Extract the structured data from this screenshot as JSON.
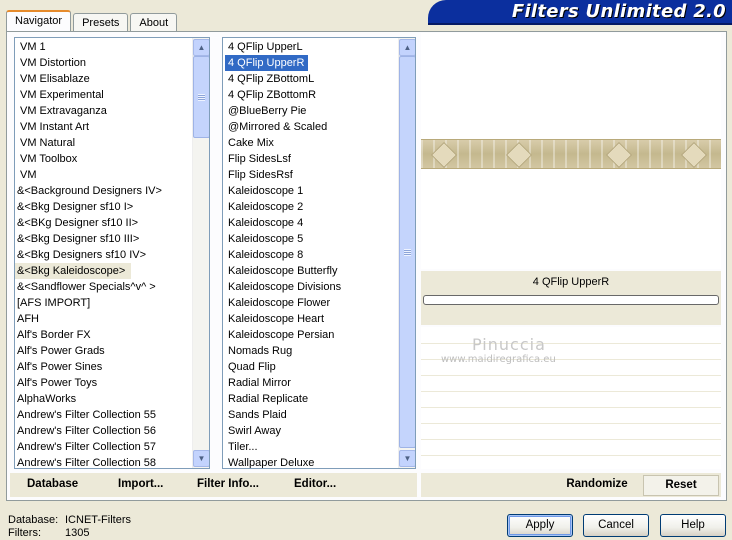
{
  "tabs": [
    "Navigator",
    "Presets",
    "About"
  ],
  "app_title": "Filters Unlimited 2.0",
  "categories": [
    "VM 1",
    "VM Distortion",
    "VM Elisablaze",
    "VM Experimental",
    "VM Extravaganza",
    "VM Instant Art",
    "VM Natural",
    "VM Toolbox",
    "VM",
    "&<Background Designers IV>",
    "&<Bkg Designer sf10 I>",
    "&<BKg Designer sf10 II>",
    "&<Bkg Designer sf10 III>",
    "&<Bkg Designers sf10 IV>",
    "&<Bkg Kaleidoscope>",
    "&<Sandflower Specials^v^ >",
    "[AFS IMPORT]",
    "AFH",
    "Alf's Border FX",
    "Alf's Power Grads",
    "Alf's Power Sines",
    "Alf's Power Toys",
    "AlphaWorks",
    "Andrew's Filter Collection 55",
    "Andrew's Filter Collection 56",
    "Andrew's Filter Collection 57",
    "Andrew's Filter Collection 58"
  ],
  "category_focused_index": 14,
  "filters": [
    "4 QFlip UpperL",
    "4 QFlip UpperR",
    "4 QFlip ZBottomL",
    "4 QFlip ZBottomR",
    "@BlueBerry Pie",
    "@Mirrored & Scaled",
    "Cake Mix",
    "Flip SidesLsf",
    "Flip SidesRsf",
    "Kaleidoscope 1",
    "Kaleidoscope 2",
    "Kaleidoscope 4",
    "Kaleidoscope 5",
    "Kaleidoscope 8",
    "Kaleidoscope Butterfly",
    "Kaleidoscope Divisions",
    "Kaleidoscope Flower",
    "Kaleidoscope Heart",
    "Kaleidoscope Persian",
    "Nomads Rug",
    "Quad Flip",
    "Radial Mirror",
    "Radial Replicate",
    "Sands Plaid",
    "Swirl Away",
    "Tiler...",
    "Wallpaper Deluxe"
  ],
  "filter_selected_index": 1,
  "selected_filter_name": "4 QFlip UpperR",
  "progress": 0,
  "watermark": {
    "line1": "Pinuccia",
    "line2": "www.maidiregrafica.eu"
  },
  "toolbar": {
    "database": "Database",
    "import": "Import...",
    "filter_info": "Filter Info...",
    "editor": "Editor..."
  },
  "preview_buttons": {
    "randomize": "Randomize",
    "reset": "Reset"
  },
  "status": {
    "database_label": "Database:",
    "database_value": "ICNET-Filters",
    "filters_label": "Filters:",
    "filters_value": "1305"
  },
  "dialog": {
    "apply": "Apply",
    "cancel": "Cancel",
    "help": "Help"
  },
  "colors": {
    "banner": "#0b2f9e",
    "selection": "#316ac5",
    "dialog_bg": "#ece9d8"
  }
}
